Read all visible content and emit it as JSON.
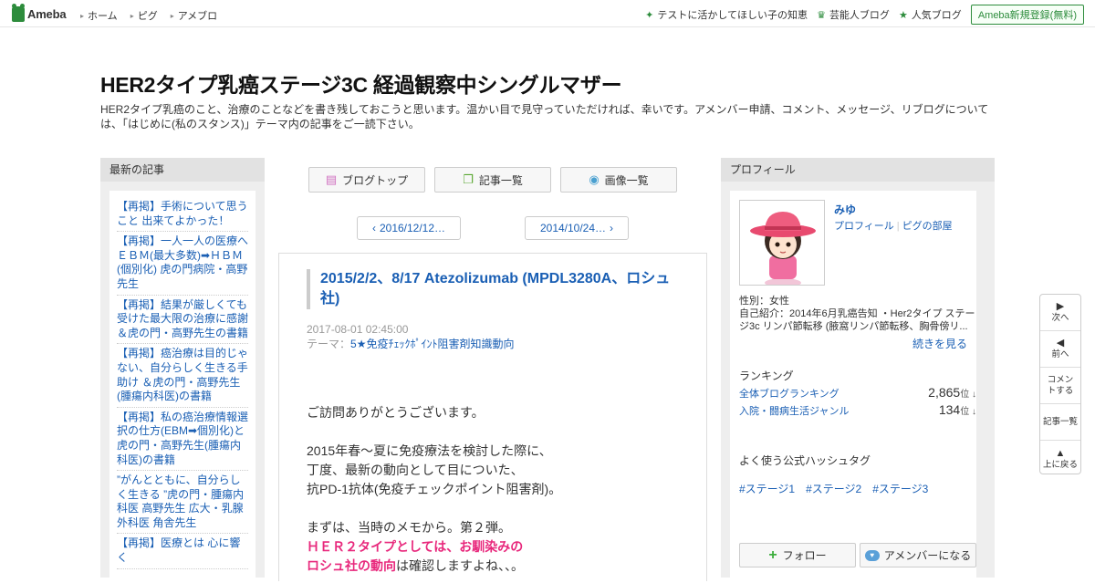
{
  "topbar": {
    "logo_text": "Ameba",
    "nav": [
      "ホーム",
      "ピグ",
      "アメブロ"
    ],
    "right_links": [
      {
        "icon": "sparkle-icon",
        "label": "テストに活かしてほしい子の知恵"
      },
      {
        "icon": "crown-icon",
        "label": "芸能人ブログ"
      },
      {
        "icon": "star-icon",
        "label": "人気ブログ"
      }
    ],
    "register_label": "Ameba新規登録(無料)"
  },
  "blog": {
    "title": "HER2タイプ乳癌ステージ3C 経過観察中シングルマザー",
    "description": "HER2タイプ乳癌のこと、治療のことなどを書き残しておこうと思います。温かい目で見守っていただければ、幸いです。アメンバー申請、コメント、メッセージ、リブログについては、「はじめに(私のスタンス)」テーマ内の記事をご一読下さい。"
  },
  "left": {
    "heading": "最新の記事",
    "entries": [
      "【再掲】手術について思うこと 出来てよかった！",
      "【再掲】一人一人の医療へ ＥＢＭ(最大多数)➡ＨＢＭ(個別化) 虎の門病院・高野先生",
      "【再掲】結果が厳しくても受けた最大限の治療に感謝 ＆虎の門・高野先生の書籍",
      "【再掲】癌治療は目的じゃない、自分らしく生きる手助け ＆虎の門・高野先生(腫瘍内科医)の書籍",
      "【再掲】私の癌治療情報選択の仕方(EBM➡個別化)と虎の門・高野先生(腫瘍内科医)の書籍",
      "”がんとともに、自分らしく生きる ”虎の門・腫瘍内科医 高野先生 広大・乳腺外科医 角舎先生",
      "【再掲】医療とは 心に響く"
    ]
  },
  "center": {
    "buttons": [
      {
        "icon": "document-icon",
        "label": "ブログトップ"
      },
      {
        "icon": "list-icon",
        "label": "記事一覧"
      },
      {
        "icon": "camera-icon",
        "label": "画像一覧"
      }
    ],
    "pager_prev": "2016/12/12…",
    "pager_next": "2014/10/24…",
    "article": {
      "title": "2015/2/2、8/17 Atezolizumab (MPDL3280A、ロシュ社)",
      "date": "2017-08-01 02:45:00",
      "theme_label": "テーマ：",
      "theme": "5★免疫ﾁｪｯｸﾎﾟｲﾝﾄ阻害剤知識動向",
      "body": {
        "p1": "ご訪問ありがとうございます。",
        "p2_l1": "2015年春～夏に免疫療法を検討した際に、",
        "p2_l2": "丁度、最新の動向として目についた、",
        "p2_l3": "抗PD-1抗体(免疫チェックポイント阻害剤)。",
        "p3_l1": "まずは、当時のメモから。第２弾。",
        "p3_pink1": "ＨＥＲ２タイプとしては、お馴染みの",
        "p3_pink2": "ロシュ社の動向",
        "p3_tail": "は確認しますよね、、。"
      }
    }
  },
  "right": {
    "heading": "プロフィール",
    "name": "みゆ",
    "link_profile": "プロフィール",
    "link_pig": "ピグの部屋",
    "gender": "性別：女性",
    "intro": "自己紹介：2014年6月乳癌告知 ・Her2タイプ ステージ3c リンパ節転移 (腋窩リンパ節転移、胸骨傍リ...",
    "more": "続きを見る",
    "ranking_head": "ランキング",
    "rankings": [
      {
        "label": "全体ブログランキング",
        "value": "2,865",
        "unit": "位"
      },
      {
        "label": "入院・闘病生活ジャンル",
        "value": "134",
        "unit": "位"
      }
    ],
    "hashtag_head": "よく使う公式ハッシュタグ",
    "hashtags": [
      "#ステージ1",
      "#ステージ2",
      "#ステージ3"
    ],
    "follow_label": "フォロー",
    "member_label": "アメンバーになる"
  },
  "sidenav": [
    {
      "icon": "triangle-right-icon",
      "label": "次へ"
    },
    {
      "icon": "triangle-left-icon",
      "label": "前へ"
    },
    {
      "icon": "",
      "label": "コメントする"
    },
    {
      "icon": "",
      "label": "記事一覧"
    },
    {
      "icon": "triangle-up-icon",
      "label": "上に戻る"
    }
  ],
  "colors": {
    "accent_green": "#2d8c3c",
    "link_blue": "#1a5fb4",
    "highlight_pink": "#e8287c"
  }
}
